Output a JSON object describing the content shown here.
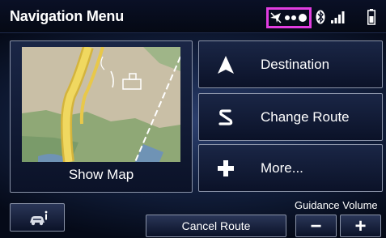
{
  "header": {
    "title": "Navigation Menu",
    "status_icons": [
      "gps-icon",
      "dots-icon",
      "bluetooth-icon",
      "signal-icon",
      "battery-icon"
    ],
    "highlight_color": "#e23de0"
  },
  "map_panel": {
    "label": "Show Map"
  },
  "menu": {
    "items": [
      {
        "label": "Destination",
        "icon": "arrow-up-icon"
      },
      {
        "label": "Change Route",
        "icon": "route-s-icon"
      },
      {
        "label": "More...",
        "icon": "plus-icon"
      }
    ]
  },
  "bottom": {
    "info_icon": "car-info-icon",
    "cancel_label": "Cancel Route",
    "volume_label": "Guidance Volume",
    "volume_minus": "−",
    "volume_plus": "+"
  }
}
